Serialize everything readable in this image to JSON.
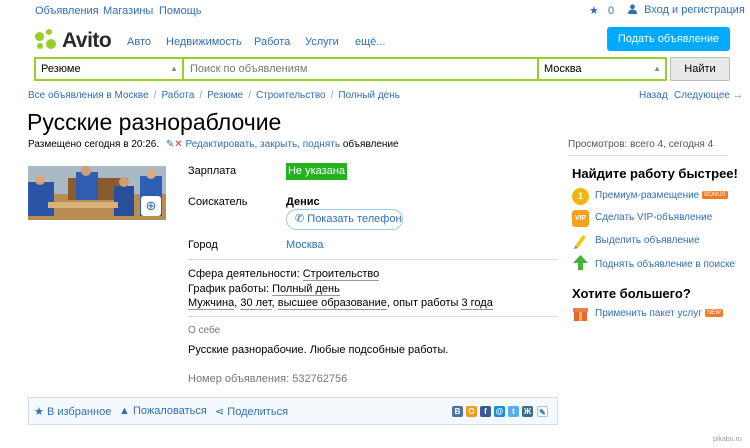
{
  "topbar": {
    "links": [
      "Объявления",
      "Магазины",
      "Помощь"
    ],
    "favorites_count": "0",
    "login": "Вход и регистрация"
  },
  "header": {
    "logo": "Avito",
    "nav": [
      "Авто",
      "Недвижимость",
      "Работа",
      "Услуги",
      "ещё..."
    ],
    "post_button": "Подать объявление"
  },
  "search": {
    "category": "Резюме",
    "placeholder": "Поиск по объявлениям",
    "city": "Москва",
    "button": "Найти"
  },
  "breadcrumb": {
    "items": [
      "Все объявления в Москве",
      "Работа",
      "Резюме",
      "Строительство",
      "Полный день"
    ],
    "back": "Назад",
    "next": "Следующее →"
  },
  "listing": {
    "title": "Русские разнораблочие",
    "posted": "Размещено сегодня в 20:26.",
    "edit_links": "Редактировать, закрыть, поднять",
    "edit_suffix": "объявление",
    "views": "Просмотров: всего 4, сегодня 4",
    "fields": {
      "salary_label": "Зарплата",
      "salary_value": "Не указана",
      "seeker_label": "Соискатель",
      "seeker_value": "Денис",
      "phone_button": "Показать телефон",
      "city_label": "Город",
      "city_value": "Москва"
    },
    "info": {
      "sphere_label": "Сфера деятельности:",
      "sphere_value": "Строительство",
      "schedule_label": "График работы:",
      "schedule_value": "Полный день",
      "gender": "Мужчина",
      "age": "30 лет",
      "education": "высшее образование",
      "experience_prefix": "опыт работы",
      "experience_value": "3 года",
      "about_label": "О себе",
      "about_text": "Русские разнорабочие. Любые подсобные работы.",
      "number": "Номер объявления: 532762756"
    },
    "actions": {
      "favorite": "В избранное",
      "complain": "Пожаловаться",
      "share": "Поделиться"
    },
    "social": [
      {
        "icon": "vk-icon",
        "glyph": "В",
        "color": "#4c75a3"
      },
      {
        "icon": "ok-icon",
        "glyph": "О",
        "color": "#f59a21"
      },
      {
        "icon": "facebook-icon",
        "glyph": "f",
        "color": "#3b5998"
      },
      {
        "icon": "mailru-icon",
        "glyph": "@",
        "color": "#168de2"
      },
      {
        "icon": "twitter-icon",
        "glyph": "t",
        "color": "#55acee"
      },
      {
        "icon": "livejournal-icon",
        "glyph": "Ж",
        "color": "#3a6c8e"
      },
      {
        "icon": "link-icon",
        "glyph": "✎",
        "color": "#2f6fb6"
      }
    ]
  },
  "sidebar": {
    "heading1": "Найдите работу быстрее!",
    "services": [
      {
        "icon": "premium-icon",
        "label": "Премиум-размещение",
        "tag": "BONUS",
        "tag_color": "#f47a20",
        "color": "#f2b705"
      },
      {
        "icon": "vip-icon",
        "label": "Сделать VIP-объявление",
        "color": "#f7a21b"
      },
      {
        "icon": "highlight-icon",
        "label": "Выделить объявление",
        "color": "#f6c21a"
      },
      {
        "icon": "lift-icon",
        "label": "Поднять объявление в поиске",
        "color": "#44b33e"
      }
    ],
    "heading2": "Хотите большего?",
    "package": {
      "label": "Применить пакет услуг",
      "tag": "NEW"
    }
  },
  "watermark": "pikabu.ru"
}
